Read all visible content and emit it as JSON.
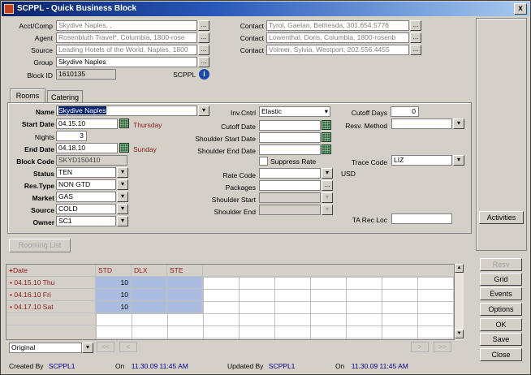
{
  "window": {
    "title": "SCPPL - Quick Business Block",
    "close_glyph": "x"
  },
  "header": {
    "acct_comp_label": "Acct/Comp",
    "acct_comp_value": "Skydive Naples, ,",
    "agent_label": "Agent",
    "agent_value": "Rosenbluth Travel*, Columbia, 1800-rose",
    "source_label": "Source",
    "source_value": "Leading Hotels of the World, Naples, 1800",
    "group_label": "Group",
    "group_value": "Skydive Naples",
    "block_id_label": "Block ID",
    "block_id_value": "1610135",
    "scppl_label": "SCPPL",
    "contact_label": "Contact",
    "contacts": [
      "Tyrol, Gaelan, Bethesda, 301.654.5776",
      "Lowenthal, Doris, Columbia, 1800-rosenb",
      "Volmer, Sylvia, Westport, 202.556.4455"
    ],
    "ellipsis": "..."
  },
  "tabs": {
    "rooms": "Rooms",
    "catering": "Catering"
  },
  "rooms": {
    "name_label": "Name",
    "name_value": "Skydive Naples",
    "start_date_label": "Start Date",
    "start_date_value": "04.15.10",
    "start_day": "Thursday",
    "nights_label": "Nights",
    "nights_value": "3",
    "end_date_label": "End Date",
    "end_date_value": "04.18.10",
    "end_day": "Sunday",
    "block_code_label": "Block Code",
    "block_code_value": "SKYD150410",
    "status_label": "Status",
    "status_value": "TEN",
    "res_type_label": "Res.Type",
    "res_type_value": "NON GTD",
    "market_label": "Market",
    "market_value": "GAS",
    "source_label": "Source",
    "source_value": "COLD",
    "owner_label": "Owner",
    "owner_value": "SC1",
    "inv_cntrl_label": "Inv.Cntrl",
    "inv_cntrl_value": "Elastic",
    "cutoff_date_label": "Cutoff Date",
    "shoulder_start_date_label": "Shoulder Start Date",
    "shoulder_end_date_label": "Shoulder End Date",
    "suppress_rate_label": "Suppress Rate",
    "rate_code_label": "Rate Code",
    "currency": "USD",
    "packages_label": "Packages",
    "shoulder_start_label": "Shoulder Start",
    "shoulder_end_label": "Shoulder End",
    "cutoff_days_label": "Cutoff Days",
    "cutoff_days_value": "0",
    "resv_method_label": "Resv. Method",
    "trace_code_label": "Trace Code",
    "trace_code_value": "LIZ",
    "ta_rec_loc_label": "TA Rec Loc",
    "dropdown_glyph": "▾"
  },
  "rooming_list_button": "Rooming List",
  "grid": {
    "date_header": "Date",
    "columns": [
      "STD",
      "DLX",
      "STE"
    ],
    "rows": [
      {
        "date": "04.15.10 Thu",
        "std": "10"
      },
      {
        "date": "04.16.10 Fri",
        "std": "10"
      },
      {
        "date": "04.17.10 Sat",
        "std": "10"
      }
    ],
    "view_value": "Original",
    "nav_first": "<<",
    "nav_prev": "<",
    "nav_next": ">",
    "nav_last": ">>"
  },
  "right_buttons": {
    "activities": "Activities",
    "resv": "Resv",
    "grid": "Grid",
    "events": "Events",
    "options": "Options",
    "ok": "OK",
    "save": "Save",
    "close": "Close"
  },
  "footer": {
    "created_by_label": "Created By",
    "created_by_value": "SCPPL1",
    "created_on_label": "On",
    "created_on_value": "11.30.09 11:45 AM",
    "updated_by_label": "Updated By",
    "updated_by_value": "SCPPL1",
    "updated_on_label": "On",
    "updated_on_value": "11.30.09 11:45 AM"
  },
  "colors": {
    "title_bar": "#0a246a",
    "date_text": "#8b1a1a",
    "grid_selected": "#aabde0",
    "footer_value": "#00008b"
  }
}
